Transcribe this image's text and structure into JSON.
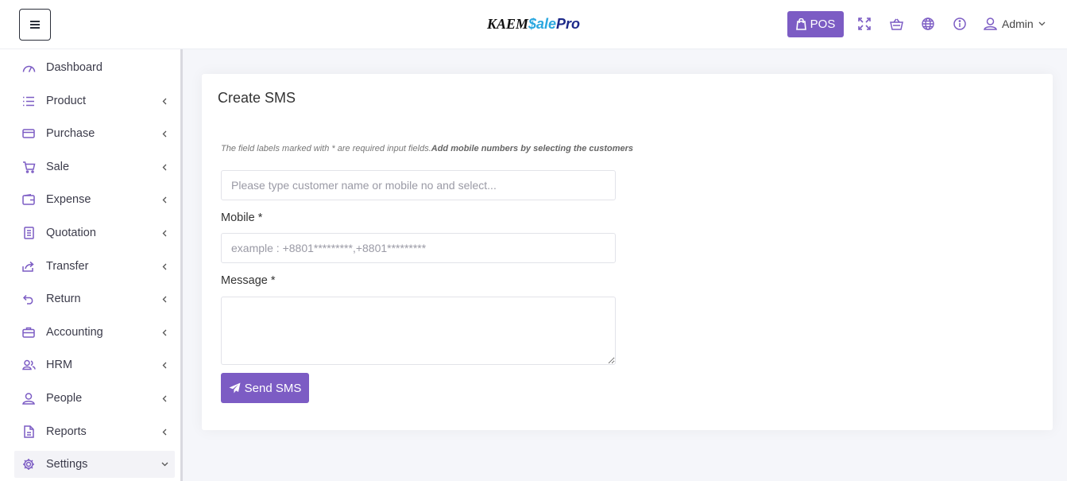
{
  "header": {
    "brand_main": "KAEM",
    "brand_accent": "$ale",
    "brand_pro": "Pro",
    "pos_label": "POS",
    "user_name": "Admin"
  },
  "sidebar": {
    "items": [
      {
        "label": "Dashboard",
        "icon": "dashboard-icon"
      },
      {
        "label": "Product",
        "icon": "list-icon"
      },
      {
        "label": "Purchase",
        "icon": "card-icon"
      },
      {
        "label": "Sale",
        "icon": "cart-icon"
      },
      {
        "label": "Expense",
        "icon": "wallet-icon"
      },
      {
        "label": "Quotation",
        "icon": "document-icon"
      },
      {
        "label": "Transfer",
        "icon": "share-icon"
      },
      {
        "label": "Return",
        "icon": "return-icon"
      },
      {
        "label": "Accounting",
        "icon": "briefcase-icon"
      },
      {
        "label": "HRM",
        "icon": "users-icon"
      },
      {
        "label": "People",
        "icon": "user-icon"
      },
      {
        "label": "Reports",
        "icon": "file-icon"
      },
      {
        "label": "Settings",
        "icon": "gear-icon"
      }
    ]
  },
  "main": {
    "title": "Create SMS",
    "hint_italic": "The field labels marked with * are required input fields.",
    "hint_bold": "Add mobile numbers by selecting the customers",
    "customer_search": {
      "placeholder": "Please type customer name or mobile no and select...",
      "value": ""
    },
    "mobile": {
      "label": "Mobile *",
      "placeholder": "example : +8801*********,+8801*********",
      "value": ""
    },
    "message": {
      "label": "Message *",
      "value": ""
    },
    "send_label": "Send SMS"
  },
  "colors": {
    "accent": "#7c5cc4",
    "brand_blue": "#2aa7df"
  }
}
